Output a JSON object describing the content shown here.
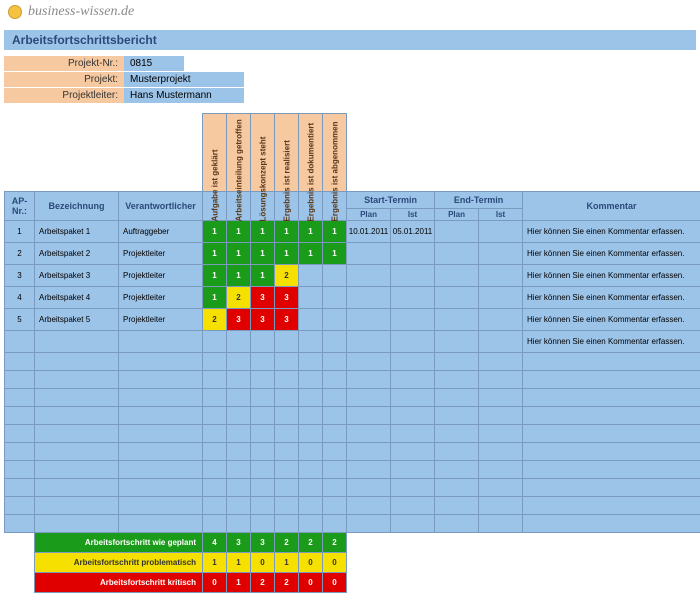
{
  "brand": "business-wissen.de",
  "title": "Arbeitsfortschrittsbericht",
  "meta": {
    "projektnr_label": "Projekt-Nr.:",
    "projektnr": "0815",
    "projekt_label": "Projekt:",
    "projekt": "Musterprojekt",
    "leiter_label": "Projektleiter:",
    "leiter": "Hans Mustermann"
  },
  "phases": [
    "Aufgabe ist geklärt",
    "Arbeitseinteilung getroffen",
    "Lösungskonzept steht",
    "Ergebnis ist realisiert",
    "Ergebnis ist dokumentiert",
    "Ergebnis ist abgenommen"
  ],
  "columns": {
    "ap": "AP-Nr.:",
    "bez": "Bezeichnung",
    "ver": "Verantwortlicher",
    "start": "Start-Termin",
    "end": "End-Termin",
    "plan": "Plan",
    "ist": "Ist",
    "kommentar": "Kommentar"
  },
  "rows": [
    {
      "ap": "1",
      "bez": "Arbeitspaket 1",
      "ver": "Auftraggeber",
      "status": [
        1,
        1,
        1,
        1,
        1,
        1
      ],
      "start_plan": "10.01.2011",
      "start_ist": "05.01.2011",
      "end_plan": "",
      "end_ist": "",
      "kommentar": "Hier können Sie einen Kommentar erfassen."
    },
    {
      "ap": "2",
      "bez": "Arbeitspaket 2",
      "ver": "Projektleiter",
      "status": [
        1,
        1,
        1,
        1,
        1,
        1
      ],
      "start_plan": "",
      "start_ist": "",
      "end_plan": "",
      "end_ist": "",
      "kommentar": "Hier können Sie einen Kommentar erfassen."
    },
    {
      "ap": "3",
      "bez": "Arbeitspaket 3",
      "ver": "Projektleiter",
      "status": [
        1,
        1,
        1,
        2,
        0,
        0
      ],
      "start_plan": "",
      "start_ist": "",
      "end_plan": "",
      "end_ist": "",
      "kommentar": "Hier können Sie einen Kommentar erfassen."
    },
    {
      "ap": "4",
      "bez": "Arbeitspaket 4",
      "ver": "Projektleiter",
      "status": [
        1,
        2,
        3,
        3,
        0,
        0
      ],
      "start_plan": "",
      "start_ist": "",
      "end_plan": "",
      "end_ist": "",
      "kommentar": "Hier können Sie einen Kommentar erfassen."
    },
    {
      "ap": "5",
      "bez": "Arbeitspaket 5",
      "ver": "Projektleiter",
      "status": [
        2,
        3,
        3,
        3,
        0,
        0
      ],
      "start_plan": "",
      "start_ist": "",
      "end_plan": "",
      "end_ist": "",
      "kommentar": "Hier können Sie einen Kommentar erfassen."
    }
  ],
  "extra_comment": "Hier können Sie einen Kommentar erfassen.",
  "summary": [
    {
      "label": "Arbeitsfortschritt wie geplant",
      "values": [
        4,
        3,
        3,
        2,
        2,
        2
      ],
      "cls": "green"
    },
    {
      "label": "Arbeitsfortschritt problematisch",
      "values": [
        1,
        1,
        0,
        1,
        0,
        0
      ],
      "cls": "yellow"
    },
    {
      "label": "Arbeitsfortschritt kritisch",
      "values": [
        0,
        1,
        2,
        2,
        0,
        0
      ],
      "cls": "red"
    }
  ],
  "chart_data": {
    "type": "table",
    "title": "Arbeitsfortschrittsbericht",
    "phases": [
      "Aufgabe ist geklärt",
      "Arbeitseinteilung getroffen",
      "Lösungskonzept steht",
      "Ergebnis ist realisiert",
      "Ergebnis ist dokumentiert",
      "Ergebnis ist abgenommen"
    ],
    "status_legend": {
      "1": "green / wie geplant",
      "2": "yellow / problematisch",
      "3": "red / kritisch",
      "0": "empty"
    },
    "rows": [
      {
        "ap": 1,
        "status": [
          1,
          1,
          1,
          1,
          1,
          1
        ]
      },
      {
        "ap": 2,
        "status": [
          1,
          1,
          1,
          1,
          1,
          1
        ]
      },
      {
        "ap": 3,
        "status": [
          1,
          1,
          1,
          2,
          0,
          0
        ]
      },
      {
        "ap": 4,
        "status": [
          1,
          2,
          3,
          3,
          0,
          0
        ]
      },
      {
        "ap": 5,
        "status": [
          2,
          3,
          3,
          3,
          0,
          0
        ]
      }
    ],
    "summary": {
      "green": [
        4,
        3,
        3,
        2,
        2,
        2
      ],
      "yellow": [
        1,
        1,
        0,
        1,
        0,
        0
      ],
      "red": [
        0,
        1,
        2,
        2,
        0,
        0
      ]
    }
  }
}
